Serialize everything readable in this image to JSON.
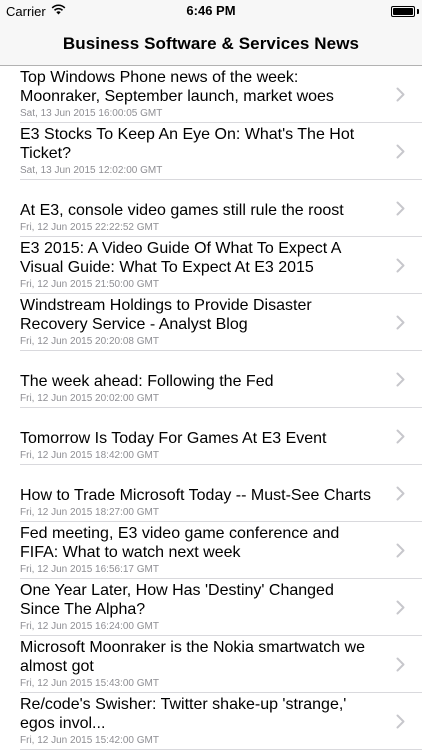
{
  "status_bar": {
    "carrier": "Carrier",
    "time": "6:46 PM",
    "battery_level": 1.0
  },
  "nav": {
    "title": "Business Software & Services News"
  },
  "articles": [
    {
      "title": "Top Windows Phone news of the week: Moonraker, September launch, market woes",
      "date": "Sat, 13 Jun 2015 16:00:05 GMT"
    },
    {
      "title": "E3 Stocks To Keep An Eye On: What's The Hot Ticket?",
      "date": "Sat, 13 Jun 2015 12:02:00 GMT"
    },
    {
      "title": "At E3, console video games still rule the roost",
      "date": "Fri, 12 Jun 2015 22:22:52 GMT"
    },
    {
      "title": "E3 2015: A Video Guide Of What To Expect A Visual Guide: What To Expect At E3 2015",
      "date": "Fri, 12 Jun 2015 21:50:00 GMT"
    },
    {
      "title": "Windstream Holdings to Provide Disaster Recovery Service - Analyst Blog",
      "date": "Fri, 12 Jun 2015 20:20:08 GMT"
    },
    {
      "title": "The week ahead: Following the Fed",
      "date": "Fri, 12 Jun 2015 20:02:00 GMT"
    },
    {
      "title": "Tomorrow Is Today For Games At E3 Event",
      "date": "Fri, 12 Jun 2015 18:42:00 GMT"
    },
    {
      "title": "How to Trade Microsoft Today -- Must-See Charts",
      "date": "Fri, 12 Jun 2015 18:27:00 GMT"
    },
    {
      "title": "Fed meeting, E3 video game conference and FIFA: What to watch next week",
      "date": "Fri, 12 Jun 2015 16:56:17 GMT"
    },
    {
      "title": "One Year Later, How Has 'Destiny' Changed Since The Alpha?",
      "date": "Fri, 12 Jun 2015 16:24:00 GMT"
    },
    {
      "title": "Microsoft Moonraker is the Nokia smartwatch we almost got",
      "date": "Fri, 12 Jun 2015 15:43:00 GMT"
    },
    {
      "title": "Re/code's Swisher: Twitter shake-up 'strange,' egos invol...",
      "date": "Fri, 12 Jun 2015 15:42:00 GMT"
    }
  ]
}
